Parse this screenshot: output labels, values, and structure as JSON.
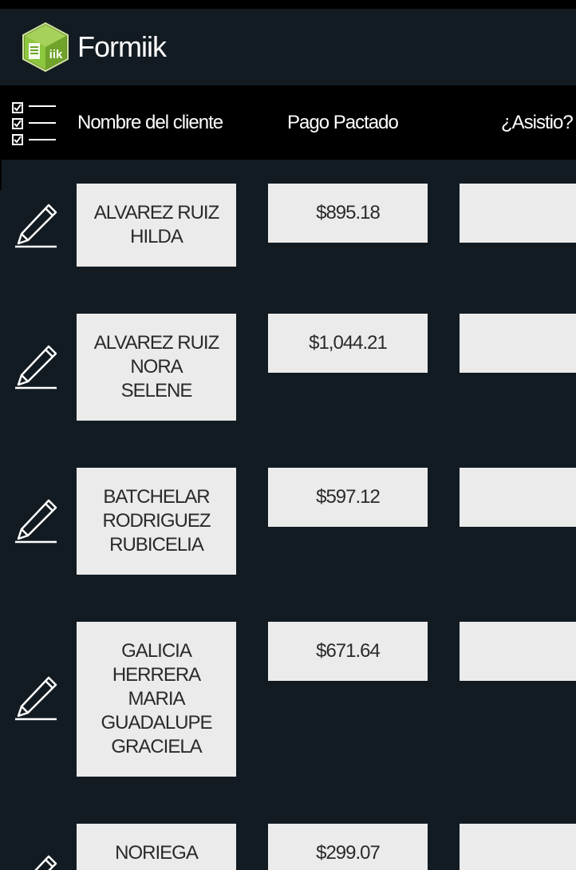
{
  "app": {
    "title": "Formiik",
    "logo_text": "iik",
    "logo_icon": "formiik-cube-logo"
  },
  "table": {
    "header_icon": "checklist-icon",
    "columns": [
      "Nombre del cliente",
      "Pago Pactado",
      "¿Asistio?"
    ],
    "rows": [
      {
        "name_lines": [
          "ALVAREZ RUIZ",
          "HILDA"
        ],
        "payment": "$895.18",
        "attended": ""
      },
      {
        "name_lines": [
          "ALVAREZ RUIZ",
          "NORA",
          "SELENE"
        ],
        "payment": "$1,044.21",
        "attended": ""
      },
      {
        "name_lines": [
          "BATCHELAR",
          "RODRIGUEZ",
          "RUBICELIA"
        ],
        "payment": "$597.12",
        "attended": ""
      },
      {
        "name_lines": [
          "GALICIA",
          "HERRERA",
          "MARIA",
          "GUADALUPE",
          "GRACIELA"
        ],
        "payment": "$671.64",
        "attended": ""
      },
      {
        "name_lines": [
          "NORIEGA"
        ],
        "payment": "$299.07",
        "attended": ""
      }
    ],
    "row_icon": "pencil-edit-icon"
  },
  "colors": {
    "background": "#131b22",
    "header_bar": "#000000",
    "cell": "#ebebeb",
    "logo_green": "#8dc63f"
  }
}
